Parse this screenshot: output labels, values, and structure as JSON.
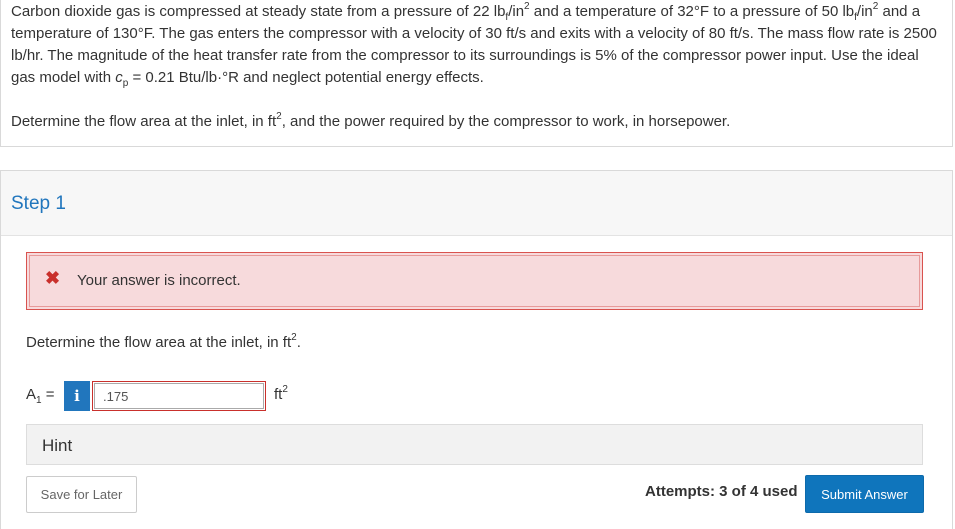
{
  "problem": {
    "s1": "Carbon dioxide gas is compressed at steady state from a pressure of 22 lb",
    "sub_f": "f",
    "s2": "/in",
    "sup_2": "2",
    "s3": " and a temperature of 32°F to a pressure of 50 lb",
    "s4": "and a temperature of 130°F. The gas enters the compressor with a velocity of 30 ft/s and exits with a velocity of 80 ft/s. The mass flow rate is 2500 lb/hr. The magnitude of the heat transfer rate from the compressor to its surroundings is 5% of the compressor power input. Use the ideal gas model with ",
    "cp_c": "c",
    "cp_sub": "p",
    "s5": " = 0.21 Btu/lb·°R and neglect potential energy effects.",
    "question_a": "Determine the flow area at the inlet, in ft",
    "question_b": ", and the power required by the compressor to work, in horsepower."
  },
  "step": {
    "title": "Step 1",
    "alert_icon": "✖",
    "alert_text": "Your answer is incorrect.",
    "prompt_a": "Determine the flow area at the inlet, in ft",
    "prompt_sup": "2",
    "prompt_b": ".",
    "var_letter": "A",
    "var_sub": "1",
    "var_eq": " =",
    "info_icon": "i",
    "answer_value": ".175",
    "unit": "ft",
    "unit_sup": "2",
    "hint_label": "Hint",
    "save_label": "Save for Later",
    "attempts": "Attempts: 3 of 4 used",
    "submit_label": "Submit Answer"
  },
  "colors": {
    "accent": "#2176bd",
    "error_bg": "#f7dadc",
    "error_border": "#d9534f",
    "submit_bg": "#0f75bc"
  }
}
